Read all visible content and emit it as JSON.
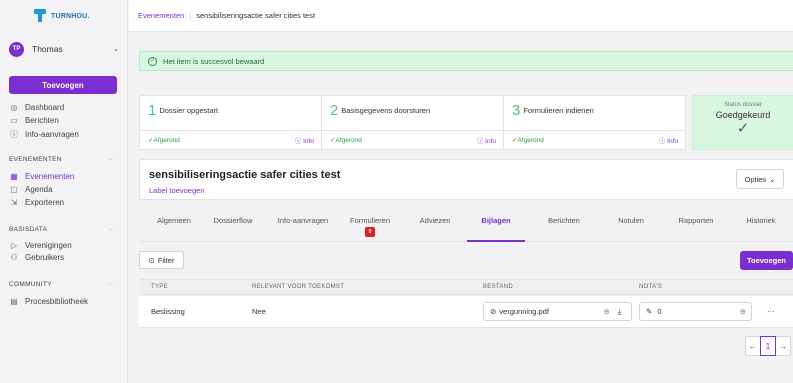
{
  "logo": {
    "text": "TURNHOU."
  },
  "user": {
    "initials": "TP",
    "name": "Thomas"
  },
  "sidebar": {
    "add_label": "Toevoegen",
    "main_items": [
      {
        "label": "Dashboard",
        "icon": "dashboard-icon"
      },
      {
        "label": "Berichten",
        "icon": "chat-icon"
      },
      {
        "label": "Info-aanvragen",
        "icon": "info-icon"
      }
    ],
    "sections": [
      {
        "title": "EVENEMENTEN",
        "items": [
          {
            "label": "Evenementen",
            "icon": "calendar-grid-icon",
            "active": true
          },
          {
            "label": "Agenda",
            "icon": "calendar-icon"
          },
          {
            "label": "Exporteren",
            "icon": "export-icon"
          }
        ]
      },
      {
        "title": "BASISDATA",
        "items": [
          {
            "label": "Verenigingen",
            "icon": "send-icon"
          },
          {
            "label": "Gebruikers",
            "icon": "users-icon"
          }
        ]
      },
      {
        "title": "COMMUNITY",
        "items": [
          {
            "label": "Procesbibliotheek",
            "icon": "library-icon"
          }
        ]
      }
    ],
    "section_menu": "···"
  },
  "breadcrumb": {
    "parent": "Evenementen",
    "separator": "|",
    "current": "sensibiliseringsactie safer cities test"
  },
  "alert": {
    "text": "Het item is succesvol bewaard",
    "icon": "check-circle-icon"
  },
  "steps": [
    {
      "number": "1",
      "title": "Dossier opgestart",
      "status": "✓Afgerond",
      "info": "ⓘ Info"
    },
    {
      "number": "2",
      "title": "Basisgegevens doorsturen",
      "status": "✓Afgerond",
      "info": "ⓘ Info"
    },
    {
      "number": "3",
      "title": "Formulieren indienen",
      "status": "✓Afgerond",
      "info": "ⓘ Info"
    }
  ],
  "status_card": {
    "label": "Status dossier",
    "value": "Goedgekeurd",
    "icon": "check-icon"
  },
  "header": {
    "title": "sensibiliseringsactie safer cities test",
    "label_link": "Label toevoegen",
    "options_label": "Opties"
  },
  "tabs": [
    {
      "label": "Algemeen"
    },
    {
      "label": "Dossierflow"
    },
    {
      "label": "Info-aanvragen"
    },
    {
      "label": "Formulieren",
      "badge": "0"
    },
    {
      "label": "Adviezen"
    },
    {
      "label": "Bijlagen",
      "active": true
    },
    {
      "label": "Berichten"
    },
    {
      "label": "Notulen"
    },
    {
      "label": "Rapporten"
    },
    {
      "label": "Historiek"
    }
  ],
  "toolbar": {
    "filter_label": "Filter",
    "add_label": "Toevoegen"
  },
  "table": {
    "columns": [
      "TYPE",
      "RELEVANT VOOR TOEKOMST",
      "BESTAND",
      "NOTA'S"
    ],
    "rows": [
      {
        "type": "Beslissing",
        "relevant": "Nee",
        "file": "vergunning.pdf",
        "notes": "0"
      }
    ]
  },
  "pagination": {
    "prev": "←",
    "current": "1",
    "next": "→"
  },
  "colors": {
    "accent": "#7b2fd0",
    "success": "#2e9a4a",
    "success_bg": "#d9f7e0",
    "danger": "#e02020"
  }
}
